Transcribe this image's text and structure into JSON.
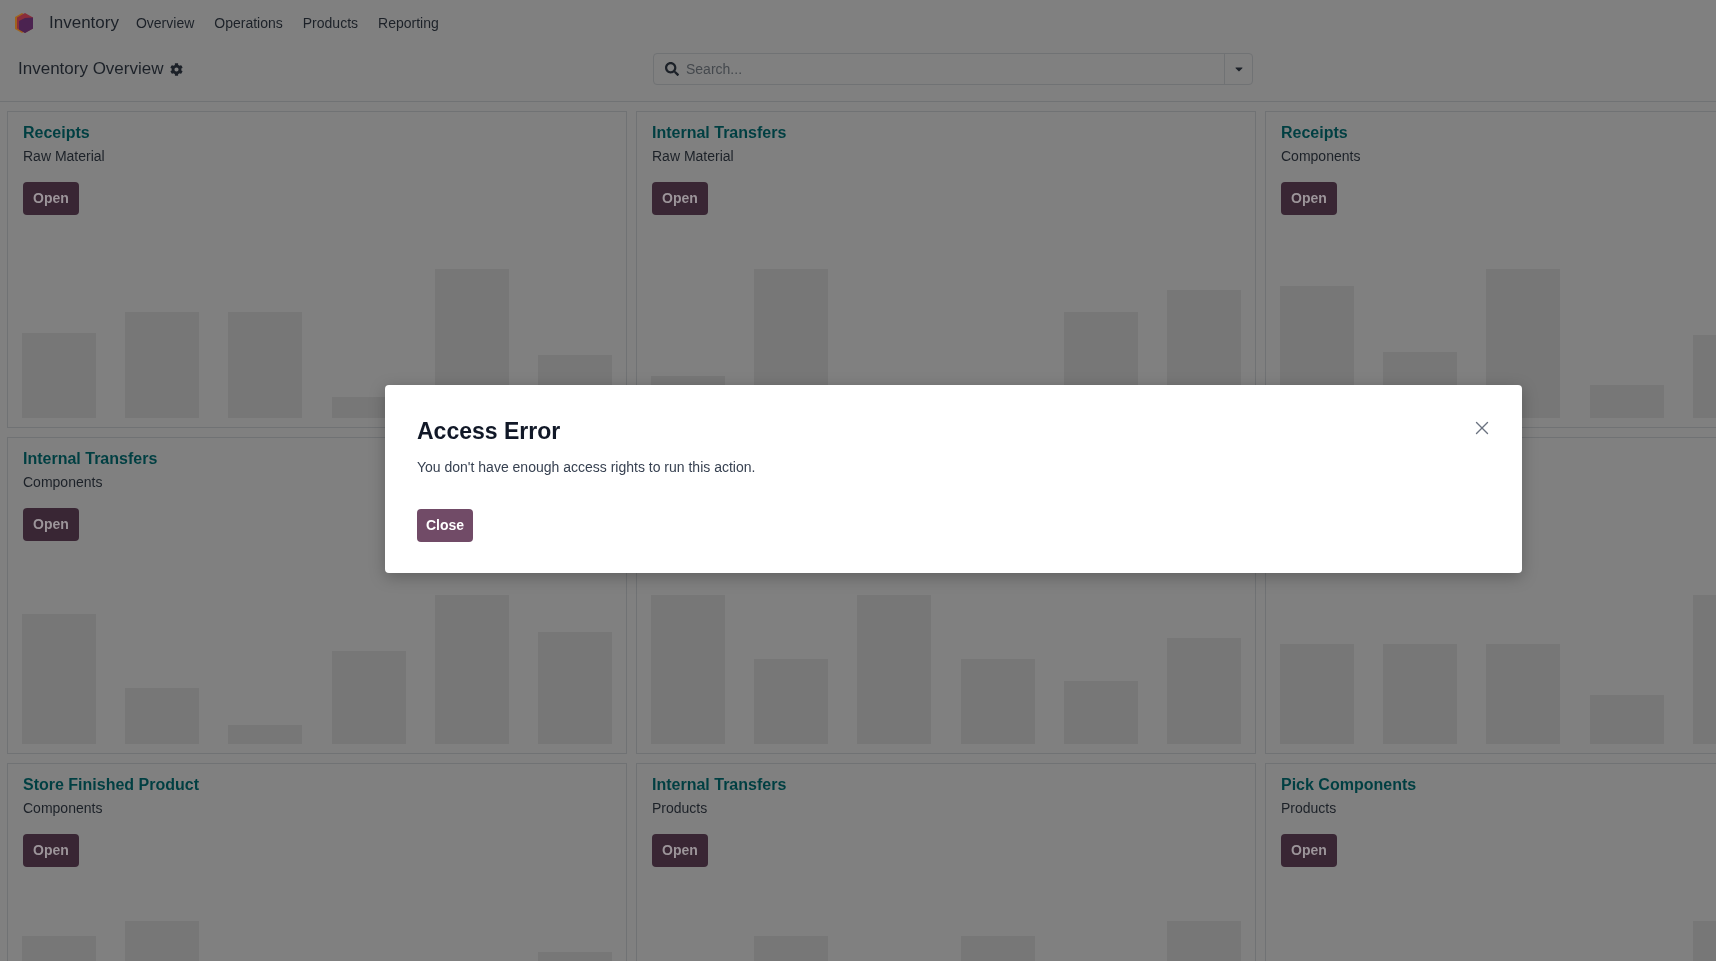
{
  "navbar": {
    "app_name": "Inventory",
    "menu": [
      "Overview",
      "Operations",
      "Products",
      "Reporting"
    ]
  },
  "control_panel": {
    "title": "Inventory Overview",
    "search": {
      "placeholder": "Search..."
    }
  },
  "cards": [
    {
      "kind": "full",
      "title": "Receipts",
      "subtitle": "Raw Material",
      "button": "Open"
    },
    {
      "kind": "full",
      "title": "Internal Transfers",
      "subtitle": "Raw Material",
      "button": "Open"
    },
    {
      "kind": "full",
      "title": "Receipts",
      "subtitle": "Components",
      "button": "Open"
    },
    {
      "kind": "full",
      "title": "Internal Transfers",
      "subtitle": "Components",
      "button": "Open"
    },
    {
      "kind": "graph"
    },
    {
      "kind": "graph"
    },
    {
      "kind": "full",
      "title": "Store Finished Product",
      "subtitle": "Components",
      "button": "Open"
    },
    {
      "kind": "full",
      "title": "Internal Transfers",
      "subtitle": "Products",
      "button": "Open"
    },
    {
      "kind": "full",
      "title": "Pick Components",
      "subtitle": "Products",
      "button": "Open"
    }
  ],
  "dialog": {
    "title": "Access Error",
    "message": "You don't have enough access rights to run this action.",
    "button": "Close"
  }
}
